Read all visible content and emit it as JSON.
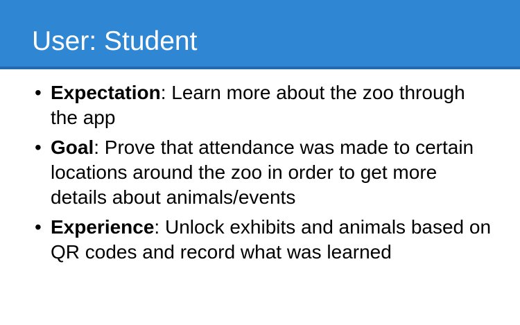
{
  "slide": {
    "title": "User: Student",
    "bullets": [
      {
        "term": "Expectation",
        "text": ": Learn more about the zoo through the app"
      },
      {
        "term": "Goal",
        "text": ": Prove that attendance was made to certain locations around the zoo in order to get more details about animals/events"
      },
      {
        "term": "Experience",
        "text": ": Unlock exhibits and animals based on QR codes and record what was learned"
      }
    ],
    "colors": {
      "title_bar": "#2f87d4",
      "title_bar_border": "#2269ad",
      "title_text": "#ffffff",
      "body_text": "#000000"
    }
  }
}
